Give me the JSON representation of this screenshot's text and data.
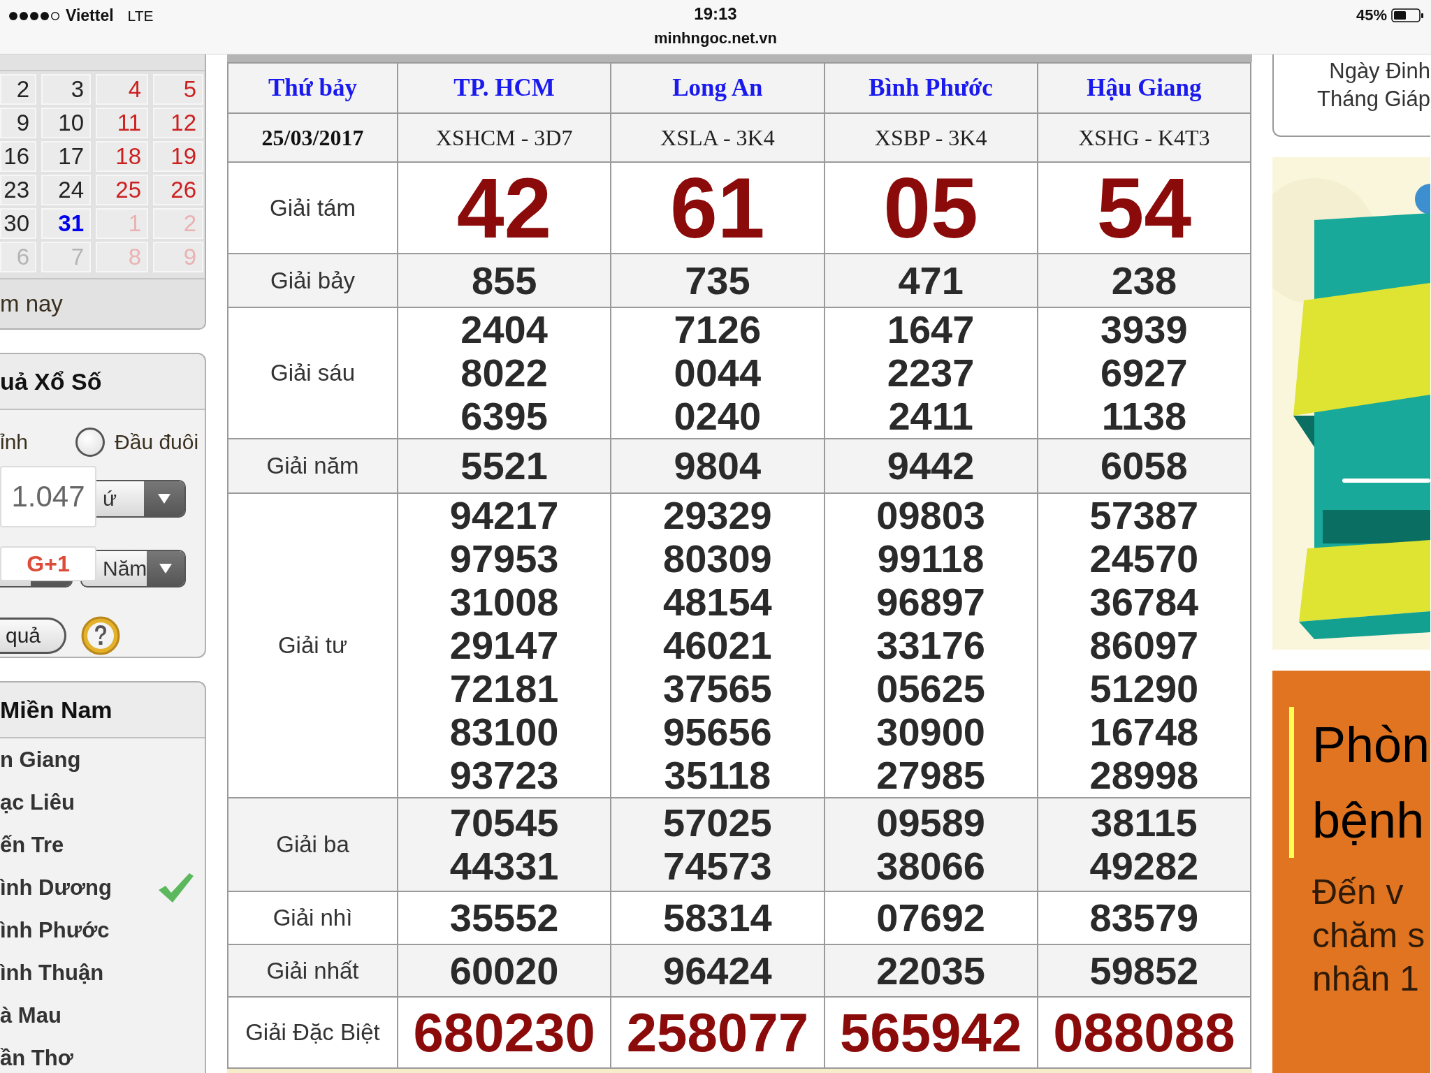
{
  "status_bar": {
    "carrier": "Viettel",
    "network": "LTE",
    "time": "19:13",
    "url": "minhngoc.net.vn",
    "battery": "45%"
  },
  "calendar": {
    "weeks": [
      [
        {
          "day": "2",
          "weekend": false,
          "today": false,
          "outside_month": false
        },
        {
          "day": "3",
          "weekend": false,
          "today": false,
          "outside_month": false
        },
        {
          "day": "4",
          "weekend": true,
          "today": false,
          "outside_month": false
        },
        {
          "day": "5",
          "weekend": true,
          "today": false,
          "outside_month": false
        }
      ],
      [
        {
          "day": "9",
          "weekend": false,
          "today": false,
          "outside_month": false
        },
        {
          "day": "10",
          "weekend": false,
          "today": false,
          "outside_month": false
        },
        {
          "day": "11",
          "weekend": true,
          "today": false,
          "outside_month": false
        },
        {
          "day": "12",
          "weekend": true,
          "today": false,
          "outside_month": false
        }
      ],
      [
        {
          "day": "16",
          "weekend": false,
          "today": false,
          "outside_month": false
        },
        {
          "day": "17",
          "weekend": false,
          "today": false,
          "outside_month": false
        },
        {
          "day": "18",
          "weekend": true,
          "today": false,
          "outside_month": false
        },
        {
          "day": "19",
          "weekend": true,
          "today": false,
          "outside_month": false
        }
      ],
      [
        {
          "day": "23",
          "weekend": false,
          "today": false,
          "outside_month": false
        },
        {
          "day": "24",
          "weekend": false,
          "today": false,
          "outside_month": false
        },
        {
          "day": "25",
          "weekend": true,
          "today": false,
          "outside_month": false
        },
        {
          "day": "26",
          "weekend": true,
          "today": false,
          "outside_month": false
        }
      ],
      [
        {
          "day": "30",
          "weekend": false,
          "today": false,
          "outside_month": false
        },
        {
          "day": "31",
          "weekend": false,
          "today": true,
          "outside_month": false
        },
        {
          "day": "1",
          "weekend": true,
          "today": false,
          "outside_month": true
        },
        {
          "day": "2",
          "weekend": true,
          "today": false,
          "outside_month": true
        }
      ],
      [
        {
          "day": "6",
          "weekend": false,
          "today": false,
          "outside_month": true
        },
        {
          "day": "7",
          "weekend": false,
          "today": false,
          "outside_month": true
        },
        {
          "day": "8",
          "weekend": true,
          "today": false,
          "outside_month": true
        },
        {
          "day": "9",
          "weekend": true,
          "today": false,
          "outside_month": true
        }
      ]
    ],
    "footer": "m nay"
  },
  "search_panel": {
    "title": "uả Xổ Số",
    "options": [
      {
        "label": "ỉnh"
      },
      {
        "label": "Đầu đuôi",
        "selected": false
      }
    ],
    "select_rows": [
      [
        {
          "value": "ứ"
        }
      ],
      [
        {},
        {
          "value": "Năm"
        }
      ]
    ],
    "button": "quả",
    "share_count": "1.047",
    "share_button": "G+1"
  },
  "provinces": {
    "title": "Miền Nam",
    "items": [
      {
        "name": "n Giang",
        "checked": false
      },
      {
        "name": "ạc Liêu",
        "checked": false
      },
      {
        "name": "ến Tre",
        "checked": false
      },
      {
        "name": "ình Dương",
        "checked": true
      },
      {
        "name": "ình Phước",
        "checked": false
      },
      {
        "name": "ình Thuận",
        "checked": false
      },
      {
        "name": "à Mau",
        "checked": false
      },
      {
        "name": "ần Thơ",
        "checked": false
      }
    ]
  },
  "results": {
    "columns": [
      "Thứ bảy",
      "TP. HCM",
      "Long An",
      "Bình Phước",
      "Hậu Giang"
    ],
    "codes": [
      "25/03/2017",
      "XSHCM - 3D7",
      "XSLA - 3K4",
      "XSBP - 3K4",
      "XSHG - K4T3"
    ],
    "prizes": [
      {
        "name": "Giải tám",
        "kind": "eighth",
        "values": [
          [
            "42"
          ],
          [
            "61"
          ],
          [
            "05"
          ],
          [
            "54"
          ]
        ]
      },
      {
        "name": "Giải bảy",
        "kind": "normal",
        "values": [
          [
            "855"
          ],
          [
            "735"
          ],
          [
            "471"
          ],
          [
            "238"
          ]
        ]
      },
      {
        "name": "Giải sáu",
        "kind": "normal",
        "values": [
          [
            "2404",
            "8022",
            "6395"
          ],
          [
            "7126",
            "0044",
            "0240"
          ],
          [
            "1647",
            "2237",
            "2411"
          ],
          [
            "3939",
            "6927",
            "1138"
          ]
        ]
      },
      {
        "name": "Giải năm",
        "kind": "normal",
        "values": [
          [
            "5521"
          ],
          [
            "9804"
          ],
          [
            "9442"
          ],
          [
            "6058"
          ]
        ]
      },
      {
        "name": "Giải tư",
        "kind": "normal",
        "values": [
          [
            "94217",
            "97953",
            "31008",
            "29147",
            "72181",
            "83100",
            "93723"
          ],
          [
            "29329",
            "80309",
            "48154",
            "46021",
            "37565",
            "95656",
            "35118"
          ],
          [
            "09803",
            "99118",
            "96897",
            "33176",
            "05625",
            "30900",
            "27985"
          ],
          [
            "57387",
            "24570",
            "36784",
            "86097",
            "51290",
            "16748",
            "28998"
          ]
        ]
      },
      {
        "name": "Giải ba",
        "kind": "normal",
        "values": [
          [
            "70545",
            "44331"
          ],
          [
            "57025",
            "74573"
          ],
          [
            "09589",
            "38066"
          ],
          [
            "38115",
            "49282"
          ]
        ]
      },
      {
        "name": "Giải nhì",
        "kind": "normal",
        "values": [
          [
            "35552"
          ],
          [
            "58314"
          ],
          [
            "07692"
          ],
          [
            "83579"
          ]
        ]
      },
      {
        "name": "Giải nhất",
        "kind": "normal",
        "values": [
          [
            "60020"
          ],
          [
            "96424"
          ],
          [
            "22035"
          ],
          [
            "59852"
          ]
        ]
      },
      {
        "name": "Giải Đặc Biệt",
        "kind": "special",
        "values": [
          [
            "680230"
          ],
          [
            "258077"
          ],
          [
            "565942"
          ],
          [
            "088088"
          ]
        ]
      }
    ]
  },
  "lunar_box": {
    "lines": [
      "Ngày Đinh",
      "Tháng Giáp"
    ]
  },
  "promo": {
    "heading_lines": [
      "Phòn",
      "bệnh"
    ],
    "body_lines": [
      "Đến v",
      "chăm s",
      "nhân 1"
    ]
  }
}
